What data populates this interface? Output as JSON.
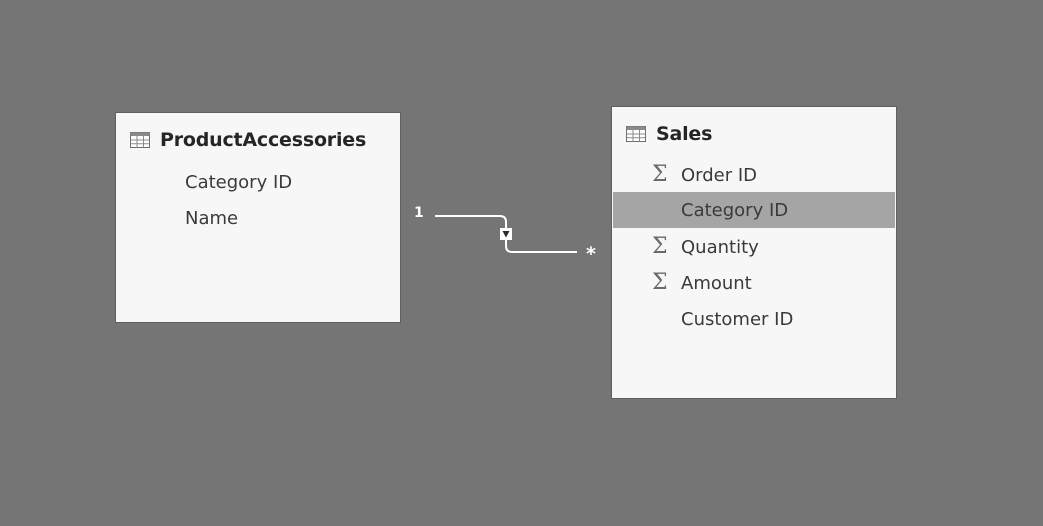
{
  "tables": {
    "product": {
      "title": "ProductAccessories",
      "icon": "table-icon",
      "fields": [
        {
          "label": "Category ID",
          "icon": ""
        },
        {
          "label": "Name",
          "icon": ""
        }
      ]
    },
    "sales": {
      "title": "Sales",
      "icon": "table-icon",
      "fields": [
        {
          "label": "Order ID",
          "icon": "sigma-icon"
        },
        {
          "label": "Category ID",
          "icon": "",
          "selected": true
        },
        {
          "label": "Quantity",
          "icon": "sigma-icon"
        },
        {
          "label": "Amount",
          "icon": "sigma-icon"
        },
        {
          "label": "Customer ID",
          "icon": ""
        }
      ]
    }
  },
  "relationship": {
    "from_cardinality": "1",
    "to_cardinality": "*",
    "filter_direction": "single",
    "from_table": "ProductAccessories",
    "to_table": "Sales"
  },
  "colors": {
    "canvas": "#757575",
    "card": "#f7f7f7",
    "selected_row": "#a5a5a5",
    "connector": "#ffffff"
  }
}
